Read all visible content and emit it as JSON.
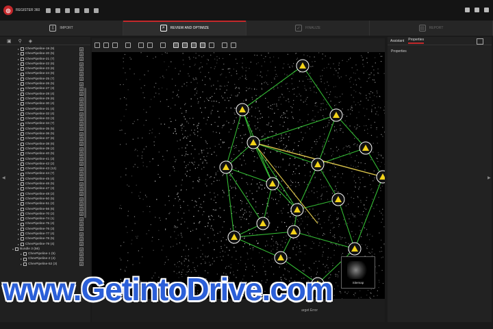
{
  "app": {
    "name": "REGISTER 360",
    "accent": "#c4282b"
  },
  "workflow": {
    "steps": [
      {
        "label": "IMPORT",
        "state": "done"
      },
      {
        "label": "REVIEW AND OPTIMIZE",
        "state": "active"
      },
      {
        "label": "FINALIZE",
        "state": "disabled"
      },
      {
        "label": "REPORT",
        "state": "disabled"
      }
    ]
  },
  "tree": {
    "items": [
      "ChevPipeline-19 (9)",
      "ChevPipeline-20 (5)",
      "ChevPipeline-21 (7)",
      "ChevPipeline-22 (6)",
      "ChevPipeline-23 (6)",
      "ChevPipeline-24 (6)",
      "ChevPipeline-25 (7)",
      "ChevPipeline-26 (5)",
      "ChevPipeline-27 (3)",
      "ChevPipeline-28 (4)",
      "ChevPipeline-29 (6)",
      "ChevPipeline-30 (4)",
      "ChevPipeline-31 (4)",
      "ChevPipeline-32 (4)",
      "ChevPipeline-33 (3)",
      "ChevPipeline-34 (7)",
      "ChevPipeline-35 (5)",
      "ChevPipeline-36 (5)",
      "ChevPipeline-37 (6)",
      "ChevPipeline-38 (6)",
      "ChevPipeline-39 (2)",
      "ChevPipeline-40 (5)",
      "ChevPipeline-41 (3)",
      "ChevPipeline-42 (2)",
      "ChevPipeline-43 (12)",
      "ChevPipeline-44 (7)",
      "ChevPipeline-45 (4)",
      "ChevPipeline-46 (5)",
      "ChevPipeline-47 (3)",
      "ChevPipeline-48 (2)",
      "ChevPipeline-50 (5)",
      "ChevPipeline-51 (2)",
      "ChevPipeline-56 (6)",
      "ChevPipeline-70 (2)",
      "ChevPipeline-74 (1)",
      "ChevPipeline-75 (4)",
      "ChevPipeline-76 (3)",
      "ChevPipeline-77 (4)",
      "ChevPipeline-78 (5)",
      "ChevPipeline-79 (4)"
    ],
    "bundle": "Bundle 3 (56)",
    "bundle_items": [
      "ChevPipeline-1 (5)",
      "ChevPipeline-2 (4)",
      "ChevPipeline-52 (3)"
    ]
  },
  "viewport": {
    "sitemap_label": "Sitemap"
  },
  "bottombar": {
    "target_error_label": "arget Error"
  },
  "rightpanel": {
    "tabs": [
      "Assistant",
      "Properties"
    ],
    "heading": "Properties"
  },
  "watermark": {
    "text": "www.GetintoDrive.com",
    "color": "#2b5fd8"
  }
}
